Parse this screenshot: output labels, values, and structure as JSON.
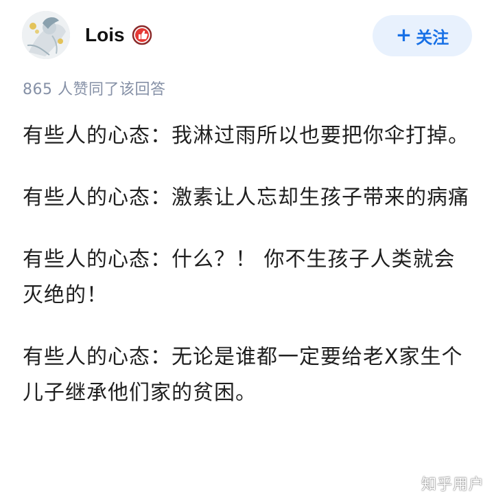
{
  "author": {
    "name": "Lois",
    "badge_icon": "thumbs-up-badge-icon",
    "badge_color": "#e53935"
  },
  "follow_button": {
    "icon": "plus-icon",
    "plus": "+",
    "label": "关注",
    "text_color": "#1770e6",
    "bg_color": "#e8f1fd"
  },
  "stats": {
    "upvote_text": "865 人赞同了该回答"
  },
  "answer": {
    "paragraphs": [
      "有些人的心态：我淋过雨所以也要把你伞打掉。",
      "有些人的心态：激素让人忘却生孩子带来的病痛",
      "有些人的心态：什么？！ 你不生孩子人类就会灭绝的！",
      "有些人的心态：无论是谁都一定要给老X家生个儿子继承他们家的贫困。"
    ]
  },
  "watermark": {
    "text": "知乎用户"
  }
}
